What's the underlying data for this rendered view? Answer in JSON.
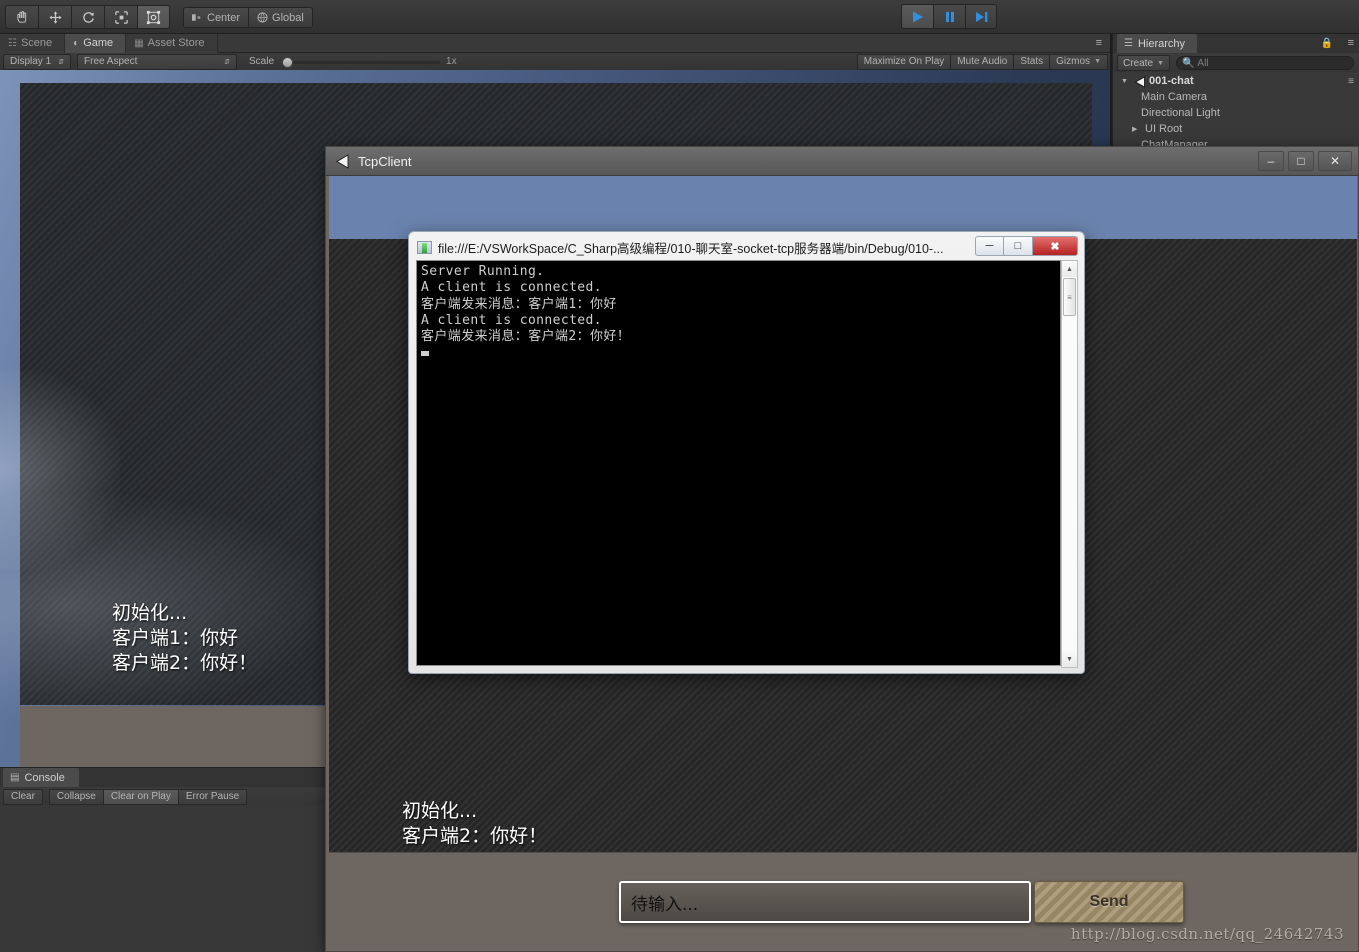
{
  "unity": {
    "toolbar": {
      "tools": [
        {
          "name": "hand-tool",
          "icon": "hand",
          "active": false
        },
        {
          "name": "move-tool",
          "icon": "move",
          "active": false
        },
        {
          "name": "rotate-tool",
          "icon": "rotate",
          "active": false
        },
        {
          "name": "scale-tool",
          "icon": "scale",
          "active": false
        },
        {
          "name": "rect-tool",
          "icon": "rect",
          "active": true
        }
      ],
      "pivot_label": "Center",
      "space_label": "Global",
      "play_label": "play",
      "pause_label": "pause",
      "step_label": "step"
    },
    "tabs": [
      {
        "label": "Scene",
        "icon": "grid-icon",
        "selected": false
      },
      {
        "label": "Game",
        "icon": "gamepad-icon",
        "selected": true
      },
      {
        "label": "Asset Store",
        "icon": "store-icon",
        "selected": false
      }
    ],
    "gamebar": {
      "display": "Display 1",
      "aspect": "Free Aspect",
      "scale_label": "Scale",
      "scale_value": "1x",
      "maximize_on_play": "Maximize On Play",
      "mute_audio": "Mute Audio",
      "stats": "Stats",
      "gizmos": "Gizmos"
    },
    "game_chat_lines": [
      "初始化...",
      "客户端1：你好",
      "客户端2：你好！"
    ],
    "console": {
      "tab_label": "Console",
      "buttons": [
        "Clear",
        "Collapse",
        "Clear on Play",
        "Error Pause"
      ]
    },
    "hierarchy": {
      "tab_label": "Hierarchy",
      "create_label": "Create",
      "search_placeholder": "All",
      "rows": [
        {
          "label": "001-chat",
          "depth": 0,
          "expanded": true,
          "root": true
        },
        {
          "label": "Main Camera",
          "depth": 1,
          "expanded": null,
          "root": false
        },
        {
          "label": "Directional Light",
          "depth": 1,
          "expanded": null,
          "root": false
        },
        {
          "label": "UI Root",
          "depth": 1,
          "expanded": false,
          "root": false
        },
        {
          "label": "ChatManager",
          "depth": 1,
          "expanded": null,
          "root": false
        }
      ]
    }
  },
  "tcpclient": {
    "title": "TcpClient",
    "minimize": "–",
    "maximize": "□",
    "close": "✕",
    "chat_lines": [
      "初始化...",
      "客户端2：你好！"
    ],
    "input_value": "待输入...",
    "send_label": "Send"
  },
  "dos_window": {
    "title": "file:///E:/VSWorkSpace/C_Sharp高级编程/010-聊天室-socket-tcp服务器端/bin/Debug/010-...",
    "minimize": "─",
    "maximize": "□",
    "close": "✖",
    "lines": [
      "Server Running.",
      "A client is connected.",
      "客户端发来消息：客户端1：你好",
      "A client is connected.",
      "客户端发来消息：客户端2：你好！"
    ],
    "scroll_up": "▲",
    "scroll_down": "▼"
  },
  "watermark": "http://blog.csdn.net/qq_24642743",
  "colors": {
    "unity_chrome": "#393939",
    "accent_blue": "#2f8fe0",
    "tcp_window": "#6e6761",
    "send_button": "#a2906b",
    "console_bg": "#000000"
  }
}
